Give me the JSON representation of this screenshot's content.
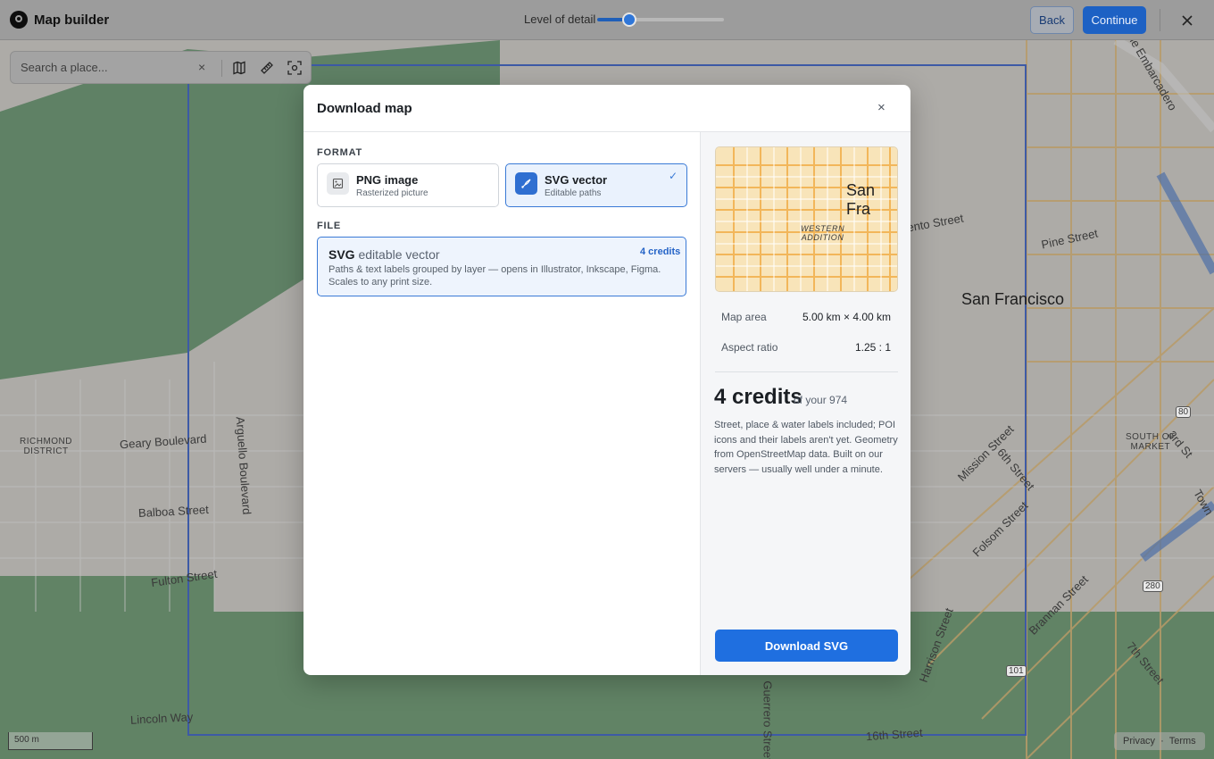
{
  "topbar": {
    "title": "Map builder",
    "level_of_detail_label": "Level of detail",
    "level_of_detail_value": 0.25,
    "back_label": "Back",
    "continue_label": "Continue",
    "close_icon": "close-icon"
  },
  "search": {
    "placeholder": "Search a place...",
    "clear_glyph": "×",
    "tools": [
      "map-icon",
      "ruler-icon",
      "screenshot-icon"
    ]
  },
  "map": {
    "labels": {
      "richmond": "RICHMOND\nDISTRICT",
      "geary": "Geary Boulevard",
      "arguello": "Arguello Boulevard",
      "balboa": "Balboa Street",
      "fulton": "Fulton Street",
      "lincoln": "Lincoln Way",
      "san_francisco": "San Francisco",
      "sacramento": "ento Street",
      "pine": "Pine Street",
      "embarcadero": "The Embarcadero",
      "south_market": "SOUTH OF\nMARKET",
      "mission": "Mission Street",
      "sixth": "6th Street",
      "third": "3rd St",
      "folsom": "Folsom Street",
      "brannan": "Brannan Street",
      "harrison": "Harrison Street",
      "seventh": "7th Street",
      "guerrero": "Guerrero Street",
      "sixteenth": "16th Street",
      "town": "Town",
      "hwy_80": "80",
      "hwy_280": "280",
      "hwy_101": "101"
    },
    "scale_label": "500 m",
    "footer": {
      "privacy": "Privacy",
      "separator": "·",
      "terms": "Terms"
    }
  },
  "modal": {
    "title": "Download map",
    "close_glyph": "×",
    "format_label": "FORMAT",
    "formats": [
      {
        "title": "PNG image",
        "subtitle": "Rasterized picture",
        "selected": false,
        "icon": "image-icon"
      },
      {
        "title": "SVG vector",
        "subtitle": "Editable paths",
        "selected": true,
        "icon": "vector-pen-icon"
      }
    ],
    "check_glyph": "✓",
    "file_label": "FILE",
    "file": {
      "format": "SVG",
      "format_desc": "editable vector",
      "credits": "4 credits",
      "description": "Paths & text labels grouped by layer — opens in Illustrator, Inkscape, Figma. Scales to any print size."
    },
    "preview": {
      "label_city": "San Fra",
      "label_district": "WESTERN\nADDITION"
    },
    "stats": {
      "map_area_label": "Map area",
      "map_area_value": "5.00 km × 4.00 km",
      "aspect_label": "Aspect ratio",
      "aspect_value": "1.25 : 1"
    },
    "credits": {
      "amount": "4 credits",
      "of_text": "of your 974",
      "description": "Street, place & water labels included; POI icons and their labels aren't yet. Geometry from OpenStreetMap data. Built on our servers — usually well under a minute."
    },
    "download_label": "Download SVG"
  },
  "colors": {
    "accent": "#1f6fe0",
    "selection_border": "#3d5aa6",
    "map_park": "#4f8a5a",
    "map_land": "#e4e1da"
  }
}
